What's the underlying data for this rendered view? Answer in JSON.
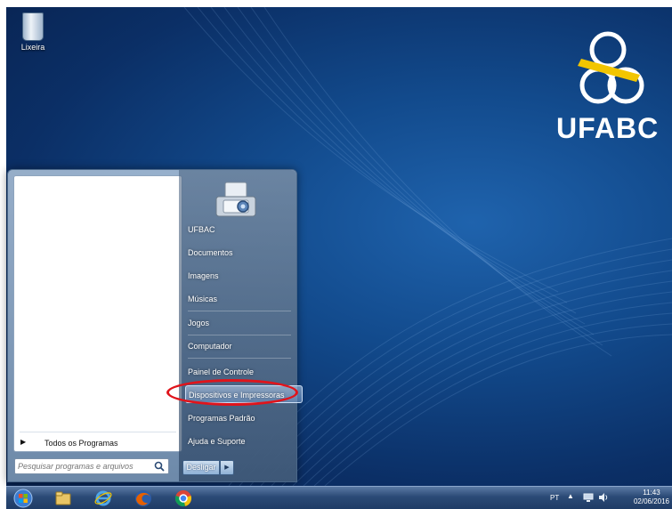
{
  "desktop": {
    "recycle_bin_label": "Lixeira",
    "logo_text": "UFABC"
  },
  "start_menu": {
    "all_programs": "Todos os Programas",
    "search_placeholder": "Pesquisar programas e arquivos",
    "shutdown_label": "Desligar",
    "items": [
      {
        "label": "UFBAC"
      },
      {
        "label": "Documentos"
      },
      {
        "label": "Imagens"
      },
      {
        "label": "Músicas"
      },
      {
        "label": "Jogos"
      },
      {
        "label": "Computador"
      },
      {
        "label": "Painel de Controle"
      },
      {
        "label": "Dispositivos e Impressoras",
        "highlighted": true
      },
      {
        "label": "Programas Padrão"
      },
      {
        "label": "Ajuda e Suporte"
      }
    ]
  },
  "taskbar": {
    "pinned": [
      "start-orb-icon",
      "windows-explorer-icon",
      "internet-explorer-icon",
      "firefox-icon",
      "chrome-icon"
    ],
    "tray": {
      "language": "PT",
      "time": "11:43",
      "date": "02/06/2016"
    }
  },
  "colors": {
    "desktop_bg": "#124a8c",
    "annotation": "#e0141b",
    "logo_yellow": "#f2c500"
  }
}
